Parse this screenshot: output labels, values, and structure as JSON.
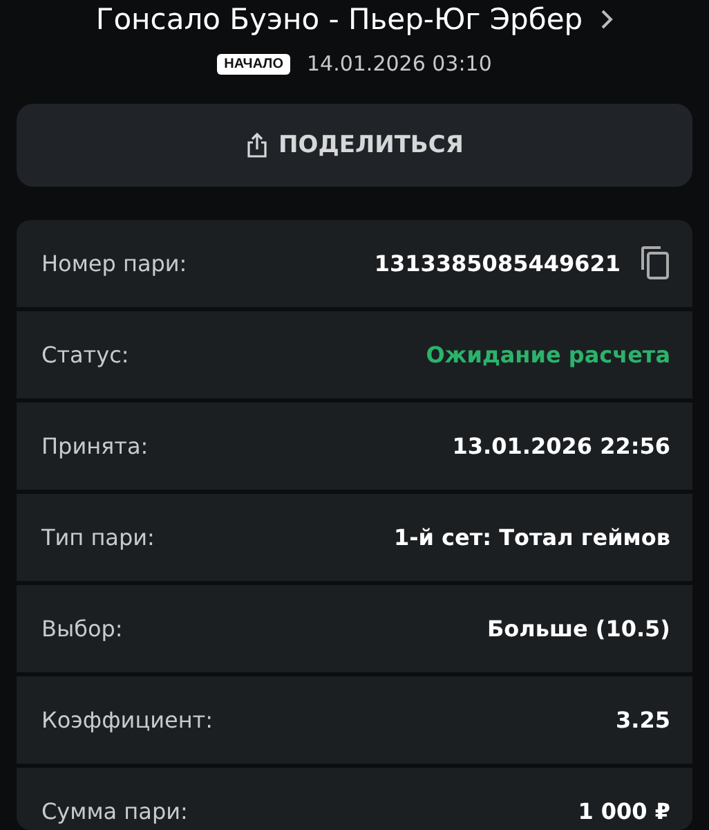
{
  "event": {
    "title": "Гонсало Буэно - Пьер-Юг Эрбер",
    "badge": "НАЧАЛО",
    "datetime": "14.01.2026 03:10"
  },
  "share_button": {
    "label": "ПОДЕЛИТЬСЯ"
  },
  "details": [
    {
      "kind": "copy",
      "label": "Номер пари:",
      "value": "1313385085449621"
    },
    {
      "kind": "status",
      "label": "Статус:",
      "value": "Ожидание расчета",
      "color": "#2bb36b"
    },
    {
      "kind": "plain",
      "label": "Принята:",
      "value": "13.01.2026 22:56"
    },
    {
      "kind": "plain",
      "label": "Тип пари:",
      "value": "1-й сет: Тотал геймов"
    },
    {
      "kind": "plain",
      "label": "Выбор:",
      "value": "Больше (10.5)"
    },
    {
      "kind": "plain",
      "label": "Коэффициент:",
      "value": "3.25"
    },
    {
      "kind": "plain",
      "label": "Сумма пари:",
      "value": "1 000 ₽"
    }
  ]
}
